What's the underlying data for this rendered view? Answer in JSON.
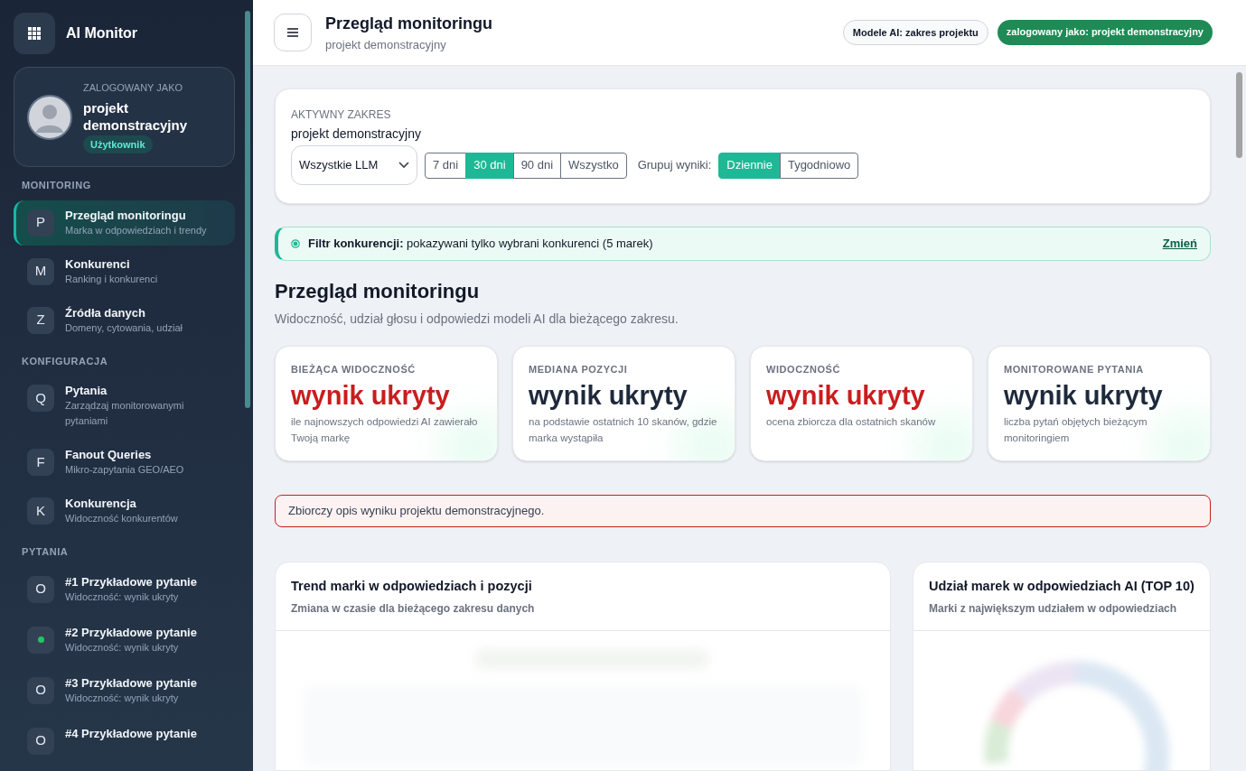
{
  "sidebar": {
    "app_name": "AI Monitor",
    "user": {
      "caption": "ZALOGOWANY JAKO",
      "name": "projekt demonstracyjny",
      "role": "Użytkownik"
    },
    "sections": [
      {
        "title": "MONITORING",
        "items": [
          {
            "kind": "letter",
            "icon": "P",
            "label": "Przegląd monitoringu",
            "sub": "Marka w odpowiedziach i trendy",
            "selected": true
          },
          {
            "kind": "letter",
            "icon": "M",
            "label": "Konkurenci",
            "sub": "Ranking i konkurenci",
            "selected": false
          },
          {
            "kind": "letter",
            "icon": "Z",
            "label": "Źródła danych",
            "sub": "Domeny, cytowania, udział",
            "selected": false
          }
        ]
      },
      {
        "title": "KONFIGURACJA",
        "items": [
          {
            "kind": "letter",
            "icon": "Q",
            "label": "Pytania",
            "sub": "Zarządzaj monitorowanymi pytaniami",
            "selected": false
          },
          {
            "kind": "letter",
            "icon": "F",
            "label": "Fanout Queries",
            "sub": "Mikro-zapytania GEO/AEO",
            "selected": false
          },
          {
            "kind": "letter",
            "icon": "K",
            "label": "Konkurencja",
            "sub": "Widoczność konkurentów",
            "selected": false
          }
        ]
      },
      {
        "title": "PYTANIA",
        "items": [
          {
            "kind": "letter",
            "icon": "O",
            "label": "#1 Przykładowe pytanie",
            "sub": "Widoczność: wynik ukryty",
            "selected": false
          },
          {
            "kind": "dot",
            "color": "#22c55e",
            "label": "#2 Przykładowe pytanie",
            "sub": "Widoczność: wynik ukryty",
            "selected": false
          },
          {
            "kind": "letter",
            "icon": "O",
            "label": "#3 Przykładowe pytanie",
            "sub": "Widoczność: wynik ukryty",
            "selected": false
          },
          {
            "kind": "letter",
            "icon": "O",
            "label": "#4 Przykładowe pytanie",
            "selected": false
          }
        ]
      }
    ]
  },
  "header": {
    "title": "Przegląd monitoringu",
    "subtitle": "projekt demonstracyjny",
    "badges": [
      {
        "text": "Modele AI: zakres projektu",
        "filled": false
      },
      {
        "text": "zalogowany jako: projekt demonstracyjny",
        "filled": true
      }
    ]
  },
  "scope": {
    "caption": "AKTYWNY ZAKRES",
    "project": "projekt demonstracyjny",
    "llm_select": "Wszystkie LLM",
    "ranges": [
      {
        "label": "7 dni",
        "selected": false
      },
      {
        "label": "30 dni",
        "selected": true
      },
      {
        "label": "90 dni",
        "selected": false
      },
      {
        "label": "Wszystko",
        "selected": false
      }
    ],
    "group_label": "Grupuj wyniki:",
    "groups": [
      {
        "label": "Dziennie",
        "selected": true
      },
      {
        "label": "Tygodniowo",
        "selected": false
      }
    ]
  },
  "filter_notice": {
    "text": "**Filtr konkurencji:** pokazywani tylko wybrani konkurenci (5 marek)",
    "link": "Zmień"
  },
  "overview": {
    "title": "Przegląd monitoringu",
    "subtitle": "Widoczność, udział głosu i odpowiedzi modeli AI dla bieżącego zakresu."
  },
  "stats": [
    {
      "label": "BIEŻĄCA WIDOCZNOŚĆ",
      "value": "wynik ukryty",
      "alert": true,
      "note": "ile najnowszych odpowiedzi AI zawierało Twoją markę"
    },
    {
      "label": "MEDIANA POZYCJI",
      "value": "wynik ukryty",
      "alert": false,
      "note": "na podstawie ostatnich 10 skanów, gdzie marka wystąpiła"
    },
    {
      "label": "WIDOCZNOŚĆ",
      "value": "wynik ukryty",
      "alert": true,
      "note": "ocena zbiorcza dla ostatnich skanów"
    },
    {
      "label": "MONITOROWANE PYTANIA",
      "value": "wynik ukryty",
      "alert": false,
      "note": "liczba pytań objętych bieżącym monitoringiem"
    }
  ],
  "summary_alert": "Zbiorczy opis wyniku projektu demonstracyjnego.",
  "panels": [
    {
      "kind": "trend",
      "title": "Trend marki w odpowiedziach i pozycji",
      "subtitle": "Zmiana w czasie dla bieżącego zakresu danych"
    },
    {
      "kind": "share",
      "title": "Udział marek w odpowiedziach AI (TOP 10)",
      "subtitle": "Marki z największym udziałem w odpowiedziach"
    }
  ]
}
